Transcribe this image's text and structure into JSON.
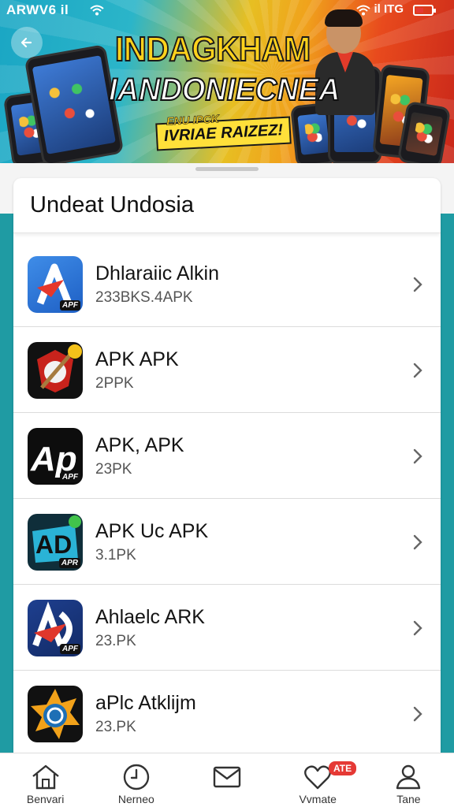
{
  "status_bar": {
    "left_text": "ARWV6 il",
    "right_text": "il ITG"
  },
  "banner": {
    "title_line1": "INDAGKHAM",
    "title_line2": "IANDONIECNEA",
    "sub_line1": "ENU IPCK",
    "sub_line2": "IVRIAE RAIZEZ!"
  },
  "card": {
    "title": "Undeat Undosia"
  },
  "apps": [
    {
      "name": "Dhlaraiic Alkin",
      "size": "233BKS.4APK",
      "badge": "APF",
      "icon": "blue-a-icon"
    },
    {
      "name": "APK APK",
      "size": "2PPK",
      "badge": "",
      "icon": "compass-shield-icon"
    },
    {
      "name": "APK, APK",
      "size": "23PK",
      "badge": "APF",
      "icon": "ap-logo-icon"
    },
    {
      "name": "APK Uc APK",
      "size": "3.1PK",
      "badge": "APR",
      "icon": "ad-teal-icon"
    },
    {
      "name": "Ahlaelc ARK",
      "size": "23.PK",
      "badge": "APF",
      "icon": "ad-red-blue-icon"
    },
    {
      "name": "aPlc Atklijm",
      "size": "23.PK",
      "badge": "",
      "icon": "star-badge-icon"
    }
  ],
  "bottom_nav": [
    {
      "label": "Benvari",
      "icon": "home-icon"
    },
    {
      "label": "Nerneo",
      "icon": "clock-icon"
    },
    {
      "label": "",
      "icon": "mail-icon"
    },
    {
      "label": "Vvmate",
      "icon": "heart-icon",
      "badge": "ATE"
    },
    {
      "label": "Tane",
      "icon": "user-icon"
    }
  ],
  "colors": {
    "accent": "#e53935",
    "teal": "#1f9ba3"
  }
}
